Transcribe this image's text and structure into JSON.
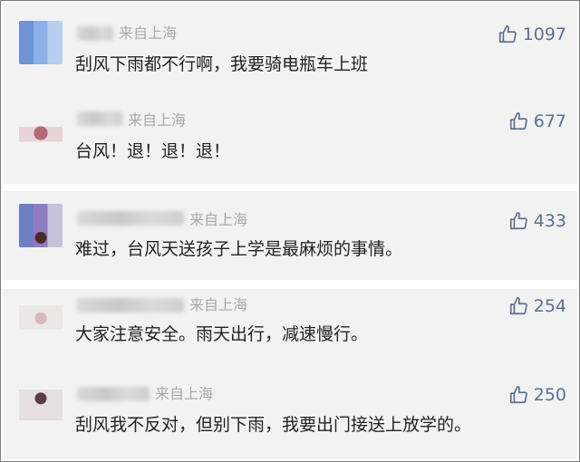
{
  "comments": [
    {
      "location": "来自上海",
      "likes": "1097",
      "text": "刮风下雨都不行啊，我要骑电瓶车上班"
    },
    {
      "location": "来自上海",
      "likes": "677",
      "text": "台风！退！退！退！"
    },
    {
      "location": "来自上海",
      "likes": "433",
      "text": "难过，台风天送孩子上学是最麻烦的事情。"
    },
    {
      "location": "来自上海",
      "likes": "254",
      "text": "大家注意安全。雨天出行，减速慢行。"
    },
    {
      "location": "来自上海",
      "likes": "250",
      "text": "刮风我不反对，但别下雨，我要出门接送上放学的。"
    }
  ],
  "icons": {
    "like": "thumbs-up-icon"
  },
  "colors": {
    "panel_bg": "#f2f2f2",
    "like_color": "#5b6f8f",
    "location_color": "#a9a9a9"
  }
}
